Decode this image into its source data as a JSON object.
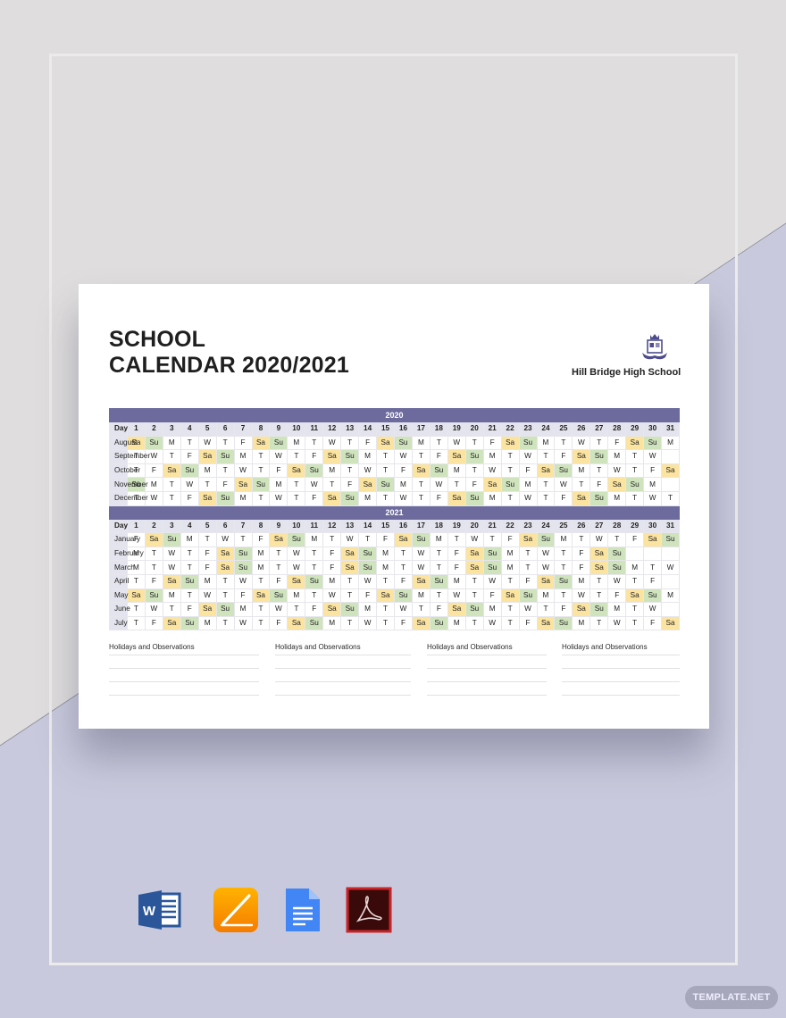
{
  "document": {
    "title_line1": "SCHOOL",
    "title_line2": "CALENDAR 2020/2021",
    "school_name": "Hill Bridge High School",
    "logo_icon": "school-crest-icon"
  },
  "colors": {
    "header_bar": "#6d6b9e",
    "saturday": "#fbe3a0",
    "sunday": "#cfe3bd",
    "label_bg": "#e4e4ee"
  },
  "calendar": {
    "day_label": "Day",
    "day_numbers": [
      "1",
      "2",
      "3",
      "4",
      "5",
      "6",
      "7",
      "8",
      "9",
      "10",
      "11",
      "12",
      "13",
      "14",
      "15",
      "16",
      "17",
      "18",
      "19",
      "20",
      "21",
      "22",
      "23",
      "24",
      "25",
      "26",
      "27",
      "28",
      "29",
      "30",
      "31"
    ],
    "blocks": [
      {
        "year": "2020",
        "months": [
          {
            "name": "August",
            "days": [
              "Sa",
              "Su",
              "M",
              "T",
              "W",
              "T",
              "F",
              "Sa",
              "Su",
              "M",
              "T",
              "W",
              "T",
              "F",
              "Sa",
              "Su",
              "M",
              "T",
              "W",
              "T",
              "F",
              "Sa",
              "Su",
              "M",
              "T",
              "W",
              "T",
              "F",
              "Sa",
              "Su",
              "M"
            ]
          },
          {
            "name": "September",
            "days": [
              "T",
              "W",
              "T",
              "F",
              "Sa",
              "Su",
              "M",
              "T",
              "W",
              "T",
              "F",
              "Sa",
              "Su",
              "M",
              "T",
              "W",
              "T",
              "F",
              "Sa",
              "Su",
              "M",
              "T",
              "W",
              "T",
              "F",
              "Sa",
              "Su",
              "M",
              "T",
              "W",
              ""
            ]
          },
          {
            "name": "October",
            "days": [
              "T",
              "F",
              "Sa",
              "Su",
              "M",
              "T",
              "W",
              "T",
              "F",
              "Sa",
              "Su",
              "M",
              "T",
              "W",
              "T",
              "F",
              "Sa",
              "Su",
              "M",
              "T",
              "W",
              "T",
              "F",
              "Sa",
              "Su",
              "M",
              "T",
              "W",
              "T",
              "F",
              "Sa"
            ]
          },
          {
            "name": "November",
            "days": [
              "Su",
              "M",
              "T",
              "W",
              "T",
              "F",
              "Sa",
              "Su",
              "M",
              "T",
              "W",
              "T",
              "F",
              "Sa",
              "Su",
              "M",
              "T",
              "W",
              "T",
              "F",
              "Sa",
              "Su",
              "M",
              "T",
              "W",
              "T",
              "F",
              "Sa",
              "Su",
              "M",
              ""
            ]
          },
          {
            "name": "December",
            "days": [
              "T",
              "W",
              "T",
              "F",
              "Sa",
              "Su",
              "M",
              "T",
              "W",
              "T",
              "F",
              "Sa",
              "Su",
              "M",
              "T",
              "W",
              "T",
              "F",
              "Sa",
              "Su",
              "M",
              "T",
              "W",
              "T",
              "F",
              "Sa",
              "Su",
              "M",
              "T",
              "W",
              "T"
            ]
          }
        ]
      },
      {
        "year": "2021",
        "months": [
          {
            "name": "January",
            "days": [
              "F",
              "Sa",
              "Su",
              "M",
              "T",
              "W",
              "T",
              "F",
              "Sa",
              "Su",
              "M",
              "T",
              "W",
              "T",
              "F",
              "Sa",
              "Su",
              "M",
              "T",
              "W",
              "T",
              "F",
              "Sa",
              "Su",
              "M",
              "T",
              "W",
              "T",
              "F",
              "Sa",
              "Su"
            ]
          },
          {
            "name": "February",
            "days": [
              "M",
              "T",
              "W",
              "T",
              "F",
              "Sa",
              "Su",
              "M",
              "T",
              "W",
              "T",
              "F",
              "Sa",
              "Su",
              "M",
              "T",
              "W",
              "T",
              "F",
              "Sa",
              "Su",
              "M",
              "T",
              "W",
              "T",
              "F",
              "Sa",
              "Su",
              "",
              "",
              ""
            ]
          },
          {
            "name": "March",
            "days": [
              "M",
              "T",
              "W",
              "T",
              "F",
              "Sa",
              "Su",
              "M",
              "T",
              "W",
              "T",
              "F",
              "Sa",
              "Su",
              "M",
              "T",
              "W",
              "T",
              "F",
              "Sa",
              "Su",
              "M",
              "T",
              "W",
              "T",
              "F",
              "Sa",
              "Su",
              "M",
              "T",
              "W"
            ]
          },
          {
            "name": "April",
            "days": [
              "T",
              "F",
              "Sa",
              "Su",
              "M",
              "T",
              "W",
              "T",
              "F",
              "Sa",
              "Su",
              "M",
              "T",
              "W",
              "T",
              "F",
              "Sa",
              "Su",
              "M",
              "T",
              "W",
              "T",
              "F",
              "Sa",
              "Su",
              "M",
              "T",
              "W",
              "T",
              "F",
              ""
            ]
          },
          {
            "name": "May",
            "days": [
              "Sa",
              "Su",
              "M",
              "T",
              "W",
              "T",
              "F",
              "Sa",
              "Su",
              "M",
              "T",
              "W",
              "T",
              "F",
              "Sa",
              "Su",
              "M",
              "T",
              "W",
              "T",
              "F",
              "Sa",
              "Su",
              "M",
              "T",
              "W",
              "T",
              "F",
              "Sa",
              "Su",
              "M"
            ]
          },
          {
            "name": "June",
            "days": [
              "T",
              "W",
              "T",
              "F",
              "Sa",
              "Su",
              "M",
              "T",
              "W",
              "T",
              "F",
              "Sa",
              "Su",
              "M",
              "T",
              "W",
              "T",
              "F",
              "Sa",
              "Su",
              "M",
              "T",
              "W",
              "T",
              "F",
              "Sa",
              "Su",
              "M",
              "T",
              "W",
              ""
            ]
          },
          {
            "name": "July",
            "days": [
              "T",
              "F",
              "Sa",
              "Su",
              "M",
              "T",
              "W",
              "T",
              "F",
              "Sa",
              "Su",
              "M",
              "T",
              "W",
              "T",
              "F",
              "Sa",
              "Su",
              "M",
              "T",
              "W",
              "T",
              "F",
              "Sa",
              "Su",
              "M",
              "T",
              "W",
              "T",
              "F",
              "Sa"
            ]
          }
        ]
      }
    ]
  },
  "holidays": {
    "sections": [
      {
        "label": "Holidays and Observations"
      },
      {
        "label": "Holidays and Observations"
      },
      {
        "label": "Holidays and Observations"
      },
      {
        "label": "Holidays and Observations"
      }
    ]
  },
  "formats": [
    {
      "name": "Microsoft Word",
      "icon": "word-icon"
    },
    {
      "name": "Apple Pages",
      "icon": "pages-icon"
    },
    {
      "name": "Google Docs",
      "icon": "google-docs-icon"
    },
    {
      "name": "Adobe PDF",
      "icon": "pdf-icon"
    }
  ],
  "watermark": {
    "label": "TEMPLATE.NET"
  }
}
